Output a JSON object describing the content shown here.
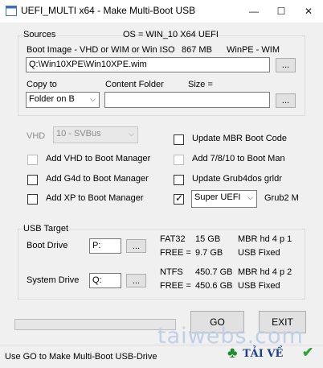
{
  "window": {
    "title": "UEFI_MULTI x64 - Make Multi-Boot USB",
    "minimize_glyph": "—",
    "maximize_glyph": "☐",
    "close_glyph": "✕"
  },
  "sources": {
    "legend": "Sources",
    "os_label": "OS = WIN_10 X64  UEFI",
    "boot_image_label": "Boot Image - VHD or WIM or Win ISO",
    "size_value": "867 MB",
    "winpe_label": "WinPE - WIM",
    "image_path": "Q:\\Win10XPE\\Win10XPE.wim",
    "browse_label": "...",
    "copy_to_label": "Copy to",
    "content_folder_label": "Content Folder",
    "size_label": "Size  =",
    "copy_to_value": "Folder on B",
    "content_folder_value": "",
    "content_browse_label": "...",
    "vhd_label": "VHD",
    "vhd_value": "10 - SVBus"
  },
  "options": {
    "add_vhd": "Add VHD to Boot Manager",
    "add_g4d": "Add G4d to Boot Manager",
    "add_xp": "Add XP  to Boot Manager",
    "update_mbr": "Update MBR Boot Code",
    "add_7810": "Add 7/8/10 to Boot Man",
    "update_grub4dos": "Update Grub4dos grldr",
    "uefi_value": "Super UEFI",
    "grub2_label": "Grub2 M"
  },
  "usb_target": {
    "legend": "USB Target",
    "boot_drive_label": "Boot  Drive",
    "boot_drive_value": "P:",
    "boot_browse": "...",
    "boot_info": {
      "fs": "FAT32",
      "total": "15 GB",
      "partition": "MBR  hd 4  p 1",
      "free_label": "FREE =",
      "free": "9.7 GB",
      "type": "USB  Fixed"
    },
    "system_drive_label": "System Drive",
    "system_drive_value": "Q:",
    "system_browse": "...",
    "system_info": {
      "fs": "NTFS",
      "total": "450.7 GB",
      "partition": "MBR  hd 4  p 2",
      "free_label": "FREE =",
      "free": "450.6 GB",
      "type": "USB  Fixed"
    }
  },
  "actions": {
    "go": "GO",
    "exit": "EXIT",
    "progress": 0
  },
  "status": {
    "text": "Use GO to Make Multi-Boot USB-Drive"
  },
  "watermark": {
    "text": "taiwebs.com",
    "logo_text": "TẢI VỀ"
  }
}
